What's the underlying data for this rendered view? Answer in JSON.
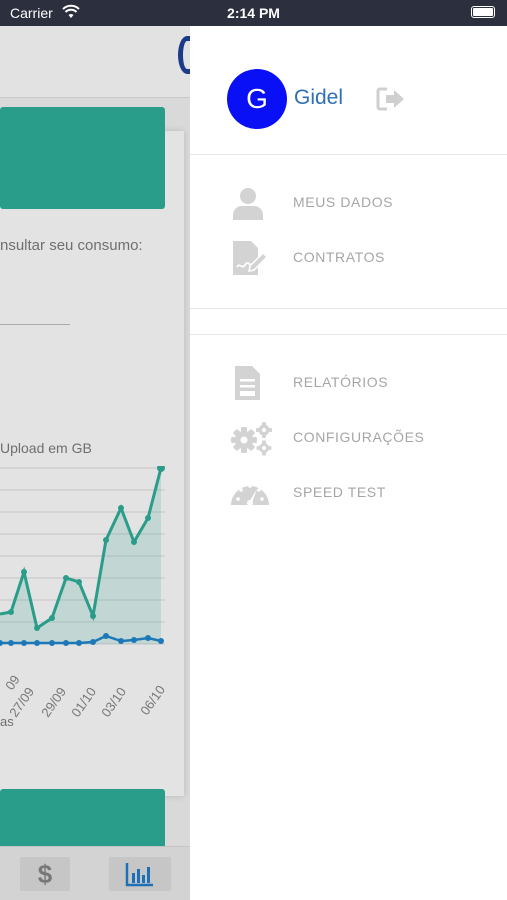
{
  "status_bar": {
    "carrier": "Carrier",
    "time": "2:14 PM"
  },
  "background": {
    "consult_text": "nsultar seu consumo:",
    "chart": {
      "title": "Upload em GB",
      "x_labels": [
        "09",
        "27/09",
        "29/09",
        "01/10",
        "03/10",
        "06/10"
      ],
      "footer_text": "as",
      "series_colors": {
        "download": "#2a9d8a",
        "upload": "#1d78b8"
      }
    },
    "tabs": [
      {
        "icon": "dollar-icon",
        "label": "$"
      },
      {
        "icon": "bar-chart-icon"
      }
    ]
  },
  "drawer": {
    "user": {
      "initial": "G",
      "name": "Gidel",
      "avatar_color": "#0a10f5"
    },
    "menu_primary": [
      {
        "icon": "user-icon",
        "label": "MEUS DADOS"
      },
      {
        "icon": "contract-icon",
        "label": "CONTRATOS"
      }
    ],
    "menu_secondary": [
      {
        "icon": "report-icon",
        "label": "RELATÓRIOS"
      },
      {
        "icon": "gears-icon",
        "label": "CONFIGURAÇÕES"
      },
      {
        "icon": "speedometer-icon",
        "label": "SPEED TEST"
      }
    ]
  }
}
